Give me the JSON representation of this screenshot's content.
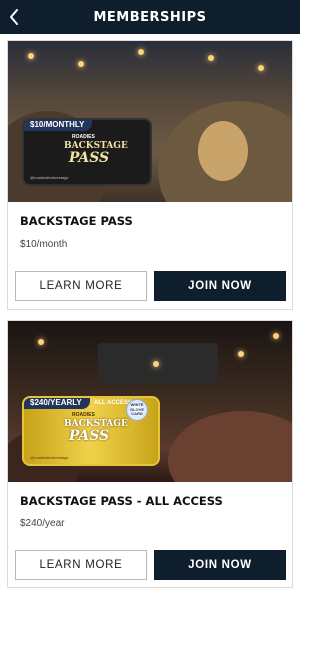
{
  "header": {
    "title": "MEMBERSHIPS",
    "back_icon": "chevron-left-icon"
  },
  "memberships": [
    {
      "promo": {
        "price_tag": "$10/MONTHLY",
        "brand": "ROADIES",
        "logo_line1": "BACKSTAGE",
        "logo_line2": "PASS",
        "footer": "@roadiesfestivestage"
      },
      "title": "BACKSTAGE PASS",
      "price": "$10/month",
      "learn_more_label": "LEARN MORE",
      "join_label": "JOIN NOW"
    },
    {
      "promo": {
        "price_tag": "$240/YEARLY",
        "access_label": "ALL ACCESS",
        "badge_text": "WHITE GLOVE CARD",
        "brand": "ROADIES",
        "logo_line1": "BACKSTAGE",
        "logo_line2": "PASS",
        "footer": "@roadiesfestivestage"
      },
      "title": "BACKSTAGE PASS - ALL ACCESS",
      "price": "$240/year",
      "learn_more_label": "LEARN MORE",
      "join_label": "JOIN NOW"
    }
  ],
  "colors": {
    "header_bg": "#0f1e2d",
    "primary_button_bg": "#0f1e2d",
    "card_border": "#dcdcdc",
    "gold_card": "#e7c53a"
  }
}
